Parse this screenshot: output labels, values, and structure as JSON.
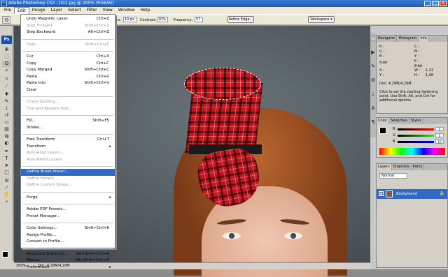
{
  "app": {
    "title": "Adobe Photoshop CS3 - [liz2.jpg @ 200% (RGB/8)]",
    "icon": "photoshop-app-icon"
  },
  "menubar": [
    "File",
    "Edit",
    "Image",
    "Layer",
    "Select",
    "Filter",
    "View",
    "Window",
    "Help"
  ],
  "options": {
    "px_suffix": "px",
    "width_value": "10 px",
    "contrast_label": "Contrast:",
    "contrast_value": "10%",
    "frequency_label": "Frequency:",
    "frequency_value": "57",
    "refine_edge": "Refine Edge...",
    "workspace": "Workspace"
  },
  "toolbox": {
    "ps_logo": "Ps"
  },
  "edit_menu": [
    {
      "label": "Undo Magnetic Lasso",
      "shortcut": "Ctrl+Z",
      "disabled": false
    },
    {
      "label": "Step Forward",
      "shortcut": "Shift+Ctrl+Z",
      "disabled": true
    },
    {
      "label": "Step Backward",
      "shortcut": "Alt+Ctrl+Z",
      "disabled": false
    },
    {
      "sep": true
    },
    {
      "label": "Fade...",
      "shortcut": "Shift+Ctrl+F",
      "disabled": true
    },
    {
      "sep": true
    },
    {
      "label": "Cut",
      "shortcut": "Ctrl+X",
      "disabled": false
    },
    {
      "label": "Copy",
      "shortcut": "Ctrl+C",
      "disabled": false
    },
    {
      "label": "Copy Merged",
      "shortcut": "Shift+Ctrl+C",
      "disabled": false
    },
    {
      "label": "Paste",
      "shortcut": "Ctrl+V",
      "disabled": false
    },
    {
      "label": "Paste Into",
      "shortcut": "Shift+Ctrl+V",
      "disabled": false
    },
    {
      "label": "Clear",
      "shortcut": "",
      "disabled": false
    },
    {
      "sep": true
    },
    {
      "label": "Check Spelling...",
      "shortcut": "",
      "disabled": true
    },
    {
      "label": "Find and Replace Text...",
      "shortcut": "",
      "disabled": true
    },
    {
      "sep": true
    },
    {
      "label": "Fill...",
      "shortcut": "Shift+F5",
      "disabled": false
    },
    {
      "label": "Stroke...",
      "shortcut": "",
      "disabled": false
    },
    {
      "sep": true
    },
    {
      "label": "Free Transform",
      "shortcut": "Ctrl+T",
      "disabled": false
    },
    {
      "label": "Transform",
      "shortcut": "",
      "disabled": false,
      "submenu": true
    },
    {
      "label": "Auto-Align Layers...",
      "shortcut": "",
      "disabled": true
    },
    {
      "label": "Auto-Blend Layers",
      "shortcut": "",
      "disabled": true
    },
    {
      "sep": true
    },
    {
      "label": "Define Brush Preset...",
      "shortcut": "",
      "disabled": false,
      "highlight": true
    },
    {
      "label": "Define Pattern...",
      "shortcut": "",
      "disabled": true
    },
    {
      "label": "Define Custom Shape...",
      "shortcut": "",
      "disabled": true
    },
    {
      "sep": true
    },
    {
      "label": "Purge",
      "shortcut": "",
      "disabled": false,
      "submenu": true
    },
    {
      "sep": true
    },
    {
      "label": "Adobe PDF Presets...",
      "shortcut": "",
      "disabled": false
    },
    {
      "label": "Preset Manager...",
      "shortcut": "",
      "disabled": false
    },
    {
      "sep": true
    },
    {
      "label": "Color Settings...",
      "shortcut": "Shift+Ctrl+K",
      "disabled": false
    },
    {
      "label": "Assign Profile...",
      "shortcut": "",
      "disabled": false
    },
    {
      "label": "Convert to Profile...",
      "shortcut": "",
      "disabled": false
    },
    {
      "sep": true
    },
    {
      "label": "Keyboard Shortcuts...",
      "shortcut": "Alt+Shift+Ctrl+K",
      "disabled": false
    },
    {
      "label": "Menus...",
      "shortcut": "Alt+Shift+Ctrl+M",
      "disabled": false
    },
    {
      "label": "Preferences",
      "shortcut": "",
      "disabled": false,
      "submenu": true
    }
  ],
  "info_panel": {
    "tabs": [
      "Navigator",
      "Histogram",
      "Info"
    ],
    "r": "R :",
    "g": "G :",
    "b": "B :",
    "c": "C :",
    "m": "M :",
    "y": "Y :",
    "k": "K :",
    "bit": "8-bit",
    "x": "X :",
    "y2": "Y :",
    "x_val": "1,22",
    "y_val": "1,46",
    "w": "W :",
    "h": "H :",
    "doc": "Doc: 4,29M/4,29M",
    "help": "Click to set the starting fastening point. Use Shift, Alt, and Ctrl for additional options."
  },
  "color_panel": {
    "tabs": [
      "Color",
      "Swatches",
      "Styles"
    ],
    "r": "R",
    "g": "G",
    "b": "B",
    "r_val": "0",
    "g_val": "5",
    "b_val": "10"
  },
  "layers_panel": {
    "tabs": [
      "Layers",
      "Channels",
      "Paths"
    ],
    "blend": "Normal",
    "layer_name": "Background"
  },
  "status": {
    "zoom": "200%",
    "doc": "Doc: 4,29M/4,29M"
  },
  "colors": {
    "accent": "#316ac5",
    "title_blue": "#1f5bb8"
  }
}
